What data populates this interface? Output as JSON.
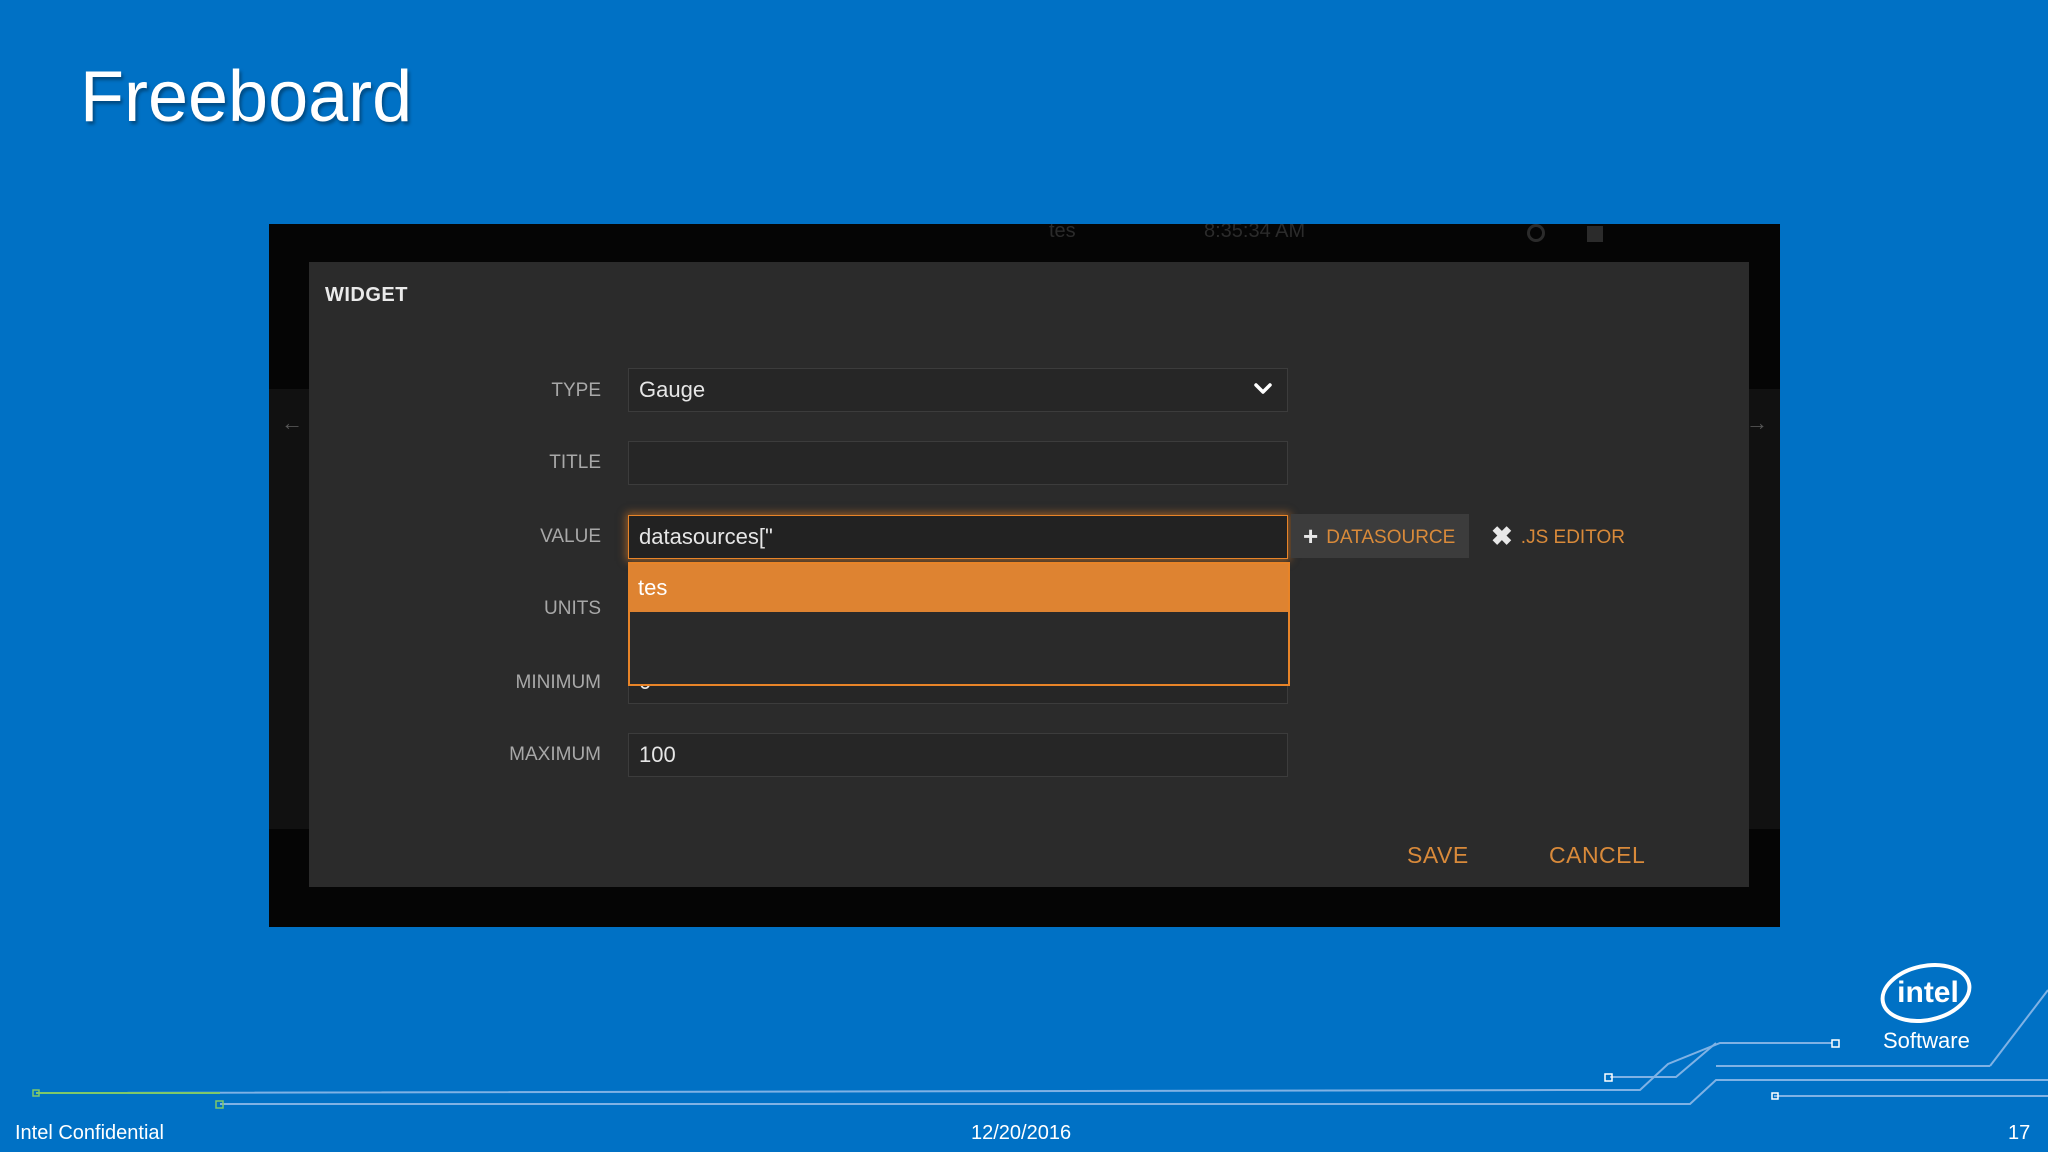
{
  "slide": {
    "title": "Freeboard",
    "footer_left": "Intel Confidential",
    "footer_center": "12/20/2016",
    "footer_right": "17",
    "logo_text": "intel",
    "logo_subtext": "Software"
  },
  "background_app": {
    "header_name": "tes",
    "header_time": "8:35:34 AM"
  },
  "modal": {
    "title": "WIDGET",
    "type_label": "TYPE",
    "type_value": "Gauge",
    "title_label": "TITLE",
    "title_value": "",
    "value_label": "VALUE",
    "value_value": "datasources[\"",
    "units_label": "UNITS",
    "minimum_label": "MINIMUM",
    "minimum_value": "0",
    "maximum_label": "MAXIMUM",
    "maximum_value": "100",
    "autocomplete_items": [
      "tes"
    ],
    "datasource_button": "DATASOURCE",
    "js_editor_button": ".JS EDITOR",
    "save_button": "SAVE",
    "cancel_button": "CANCEL"
  },
  "colors": {
    "slide_background": "#0071c5",
    "modal_background": "#2b2b2b",
    "accent": "#e88428",
    "button_text": "#d98a3a"
  },
  "icons": {
    "type_dropdown": "chevron-down-icon",
    "datasource": "plus-icon",
    "js_editor": "close-icon"
  }
}
